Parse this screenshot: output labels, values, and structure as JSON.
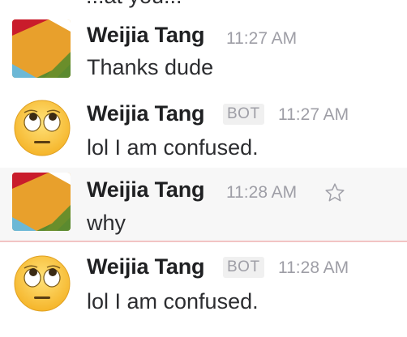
{
  "clipped_top_text": "...at you...",
  "messages": [
    {
      "author": "Weijia Tang",
      "bot_badge": "",
      "time": "11:27 AM",
      "text": "Thanks dude",
      "avatar": "slack-logo-avatar"
    },
    {
      "author": "Weijia Tang",
      "bot_badge": "BOT",
      "time": "11:27 AM",
      "text": "lol I am confused.",
      "avatar": "eye-roll-emoji-avatar"
    },
    {
      "author": "Weijia Tang",
      "bot_badge": "",
      "time": "11:28 AM",
      "text": "why",
      "avatar": "slack-logo-avatar"
    },
    {
      "author": "Weijia Tang",
      "bot_badge": "BOT",
      "time": "11:28 AM",
      "text": "lol I am confused.",
      "avatar": "eye-roll-emoji-avatar"
    }
  ],
  "colors": {
    "divider": "#f2c4c4",
    "hover_bg": "#f7f7f7",
    "timestamp": "#9e9ea6"
  }
}
